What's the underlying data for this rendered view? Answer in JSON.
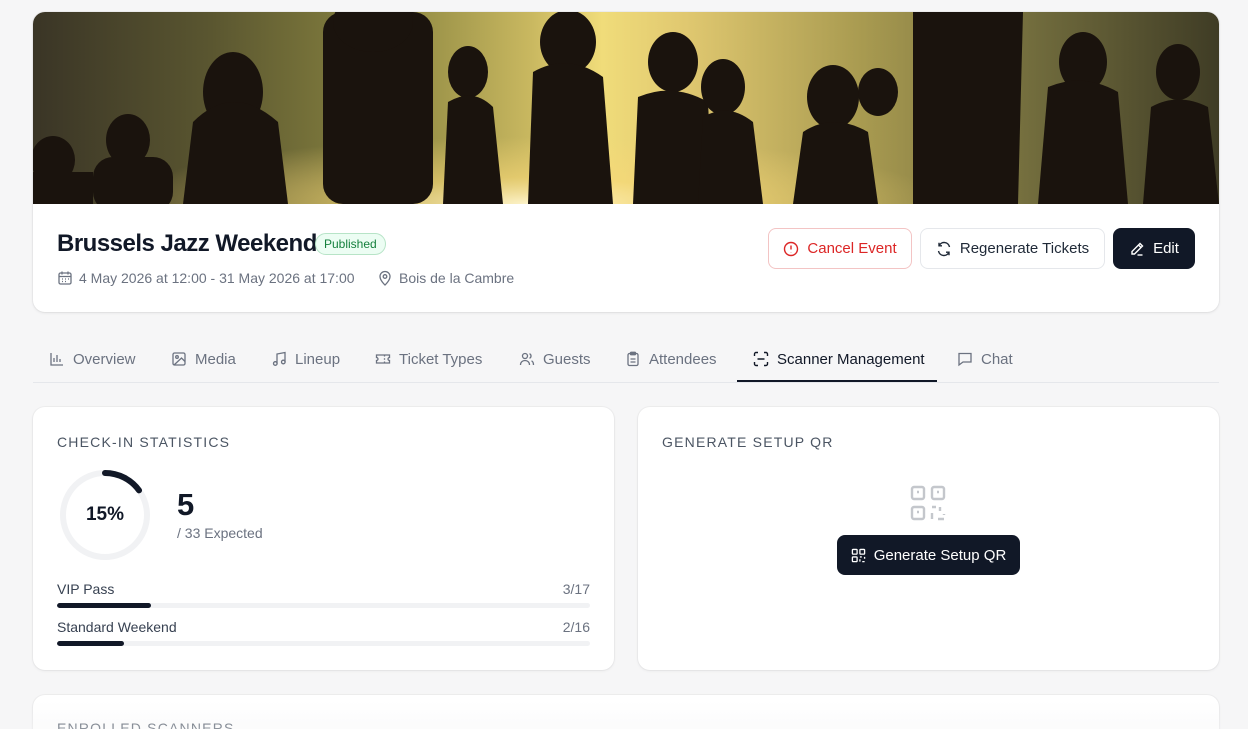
{
  "event": {
    "title": "Brussels Jazz Weekend",
    "status": "Published",
    "datetime": "4 May 2026 at 12:00 - 31 May 2026 at 17:00",
    "location": "Bois de la Cambre"
  },
  "actions": {
    "cancel_label": "Cancel Event",
    "regenerate_label": "Regenerate Tickets",
    "edit_label": "Edit"
  },
  "tabs": [
    {
      "label": "Overview",
      "icon": "bar-chart-icon"
    },
    {
      "label": "Media",
      "icon": "image-icon"
    },
    {
      "label": "Lineup",
      "icon": "music-icon"
    },
    {
      "label": "Ticket Types",
      "icon": "ticket-icon"
    },
    {
      "label": "Guests",
      "icon": "users-icon"
    },
    {
      "label": "Attendees",
      "icon": "clipboard-icon"
    },
    {
      "label": "Scanner Management",
      "icon": "scan-icon",
      "active": true
    },
    {
      "label": "Chat",
      "icon": "message-icon"
    }
  ],
  "checkin": {
    "title": "CHECK-IN STATISTICS",
    "percent_label": "15%",
    "percent": 15,
    "checked_in": "5",
    "expected_label": "/ 33 Expected",
    "ticket_types": [
      {
        "name": "VIP Pass",
        "count_label": "3/17",
        "fraction": 0.176
      },
      {
        "name": "Standard Weekend",
        "count_label": "2/16",
        "fraction": 0.125
      }
    ]
  },
  "setup_qr": {
    "title": "GENERATE SETUP QR",
    "button_label": "Generate Setup QR"
  },
  "enrolled": {
    "title": "ENROLLED SCANNERS"
  },
  "colors": {
    "primary": "#111827",
    "danger": "#dc2626",
    "success": "#15803d"
  }
}
